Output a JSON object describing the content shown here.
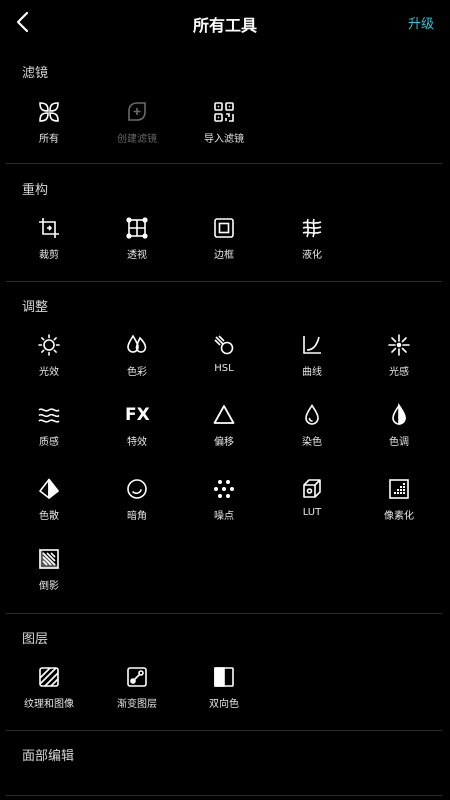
{
  "header": {
    "title": "所有工具",
    "upgrade_label": "升级"
  },
  "sections": {
    "filters": {
      "title": "滤镜",
      "items": [
        {
          "label": "所有",
          "icon": "grid-petals-icon"
        },
        {
          "label": "创建滤镜",
          "icon": "create-filter-icon",
          "disabled": true
        },
        {
          "label": "导入滤镜",
          "icon": "qr-code-icon"
        }
      ]
    },
    "reconstruct": {
      "title": "重构",
      "items": [
        {
          "label": "裁剪",
          "icon": "crop-icon"
        },
        {
          "label": "透视",
          "icon": "perspective-icon"
        },
        {
          "label": "边框",
          "icon": "frame-icon"
        },
        {
          "label": "液化",
          "icon": "liquify-icon"
        }
      ]
    },
    "adjust": {
      "title": "调整",
      "items": [
        {
          "label": "光效",
          "icon": "sun-icon"
        },
        {
          "label": "色彩",
          "icon": "drops-icon"
        },
        {
          "label": "HSL",
          "icon": "hsl-icon"
        },
        {
          "label": "曲线",
          "icon": "curve-icon"
        },
        {
          "label": "光感",
          "icon": "sparkle-icon"
        },
        {
          "label": "质感",
          "icon": "waves-icon"
        },
        {
          "label": "FX",
          "icon": "fx-icon"
        },
        {
          "label": "特效",
          "icon": "fx-label"
        },
        {
          "label": "偏移",
          "icon": "triangle-icon"
        },
        {
          "label": "染色",
          "icon": "drop-outline-icon"
        },
        {
          "label": "色调",
          "icon": "drop-half-icon"
        },
        {
          "label": "色散",
          "icon": "prism-icon"
        },
        {
          "label": "暗角",
          "icon": "vignette-icon"
        },
        {
          "label": "噪点",
          "icon": "noise-icon"
        },
        {
          "label": "LUT",
          "icon": "cube-icon"
        },
        {
          "label": "像素化",
          "icon": "pixelate-icon"
        },
        {
          "label": "倒影",
          "icon": "reflection-icon"
        }
      ]
    },
    "layers": {
      "title": "图层",
      "items": [
        {
          "label": "纹理和图像",
          "icon": "texture-icon"
        },
        {
          "label": "渐变图层",
          "icon": "gradient-icon"
        },
        {
          "label": "双向色",
          "icon": "duotone-icon"
        }
      ]
    },
    "face": {
      "title": "面部编辑"
    }
  },
  "colors": {
    "background": "#000000",
    "accent": "#2ec4d6",
    "disabled": "#6a6a6a"
  }
}
